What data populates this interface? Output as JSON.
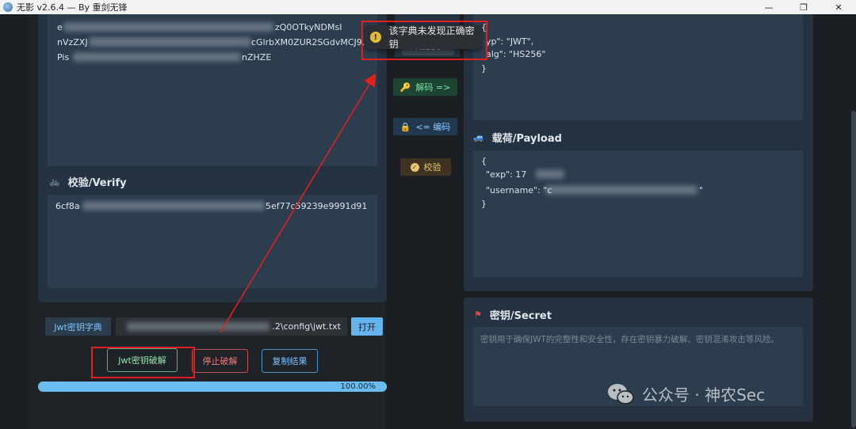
{
  "window": {
    "title": "无影 v2.6.4 — By 重剑无锋",
    "minimize": "—",
    "maximize": "❐",
    "close": "✕"
  },
  "token": {
    "line1_start": "e",
    "line1_end": "zQ0OTkyNDMsI",
    "line2_start": "nVzZXJ",
    "line2_end": "cGlrbXM0ZUR2SGdvMCJ9.b",
    "line3_start": "Pis",
    "line3_end": "nZHZE"
  },
  "verify": {
    "title": "校验/Verify",
    "signature_start": "6cf8a",
    "signature_end": "5ef77c59239e9991d91"
  },
  "dictionary": {
    "label": "Jwt密钥字典",
    "path_end": ".2\\config\\jwt.txt",
    "open_label": "打开"
  },
  "actions": {
    "crack_label": "Jwt密钥破解",
    "stop_label": "停止破解",
    "copy_label": "复制结果"
  },
  "progress": {
    "value": 1.0,
    "text": "100.00%"
  },
  "middle": {
    "algo_value": "HS256",
    "decode_label": "解码 =>",
    "encode_label": "<= 编码",
    "verify_label": "校验"
  },
  "header_json": {
    "open": "{",
    "typ_line": "yp\": \"JWT\",",
    "alg_line": "alg\": \"HS256\"",
    "close": "}"
  },
  "payload": {
    "title": "载荷/Payload",
    "open": "{",
    "exp_line": "\"exp\": 17",
    "username_line": "\"username\": \"c",
    "username_end": "\"",
    "close": "}"
  },
  "secret": {
    "title": "密钥/Secret",
    "placeholder": "密钥用于确保JWT的完整性和安全性，存在密钥暴力破解、密钥混淆攻击等风险。"
  },
  "toast": {
    "message": "该字典未发现正确密钥"
  },
  "watermark": {
    "text": "公众号 · 神农Sec"
  },
  "colors": {
    "accent_blue": "#62b3ee",
    "success_green": "#8fe3ad",
    "danger_red": "#ef7a7a",
    "warning_yellow": "#e2b93b",
    "annotation_red": "#e02020"
  },
  "icons": {
    "verify": "bicycle-icon",
    "payload": "car-icon",
    "secret": "flag-icon",
    "decode": "key-icon",
    "encode": "lock-icon",
    "check": "check-circle-icon",
    "toast": "warning-icon"
  }
}
